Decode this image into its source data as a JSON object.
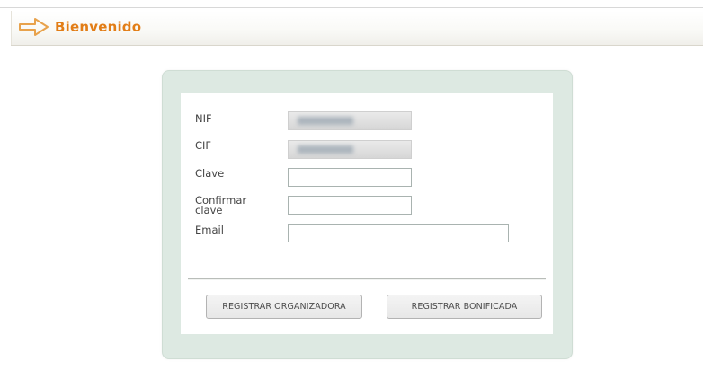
{
  "header": {
    "title": "Bienvenido",
    "icon": "arrow-right-icon",
    "title_color": "#e27d16"
  },
  "form": {
    "fields": {
      "nif": {
        "label": "NIF",
        "value": "",
        "disabled": true
      },
      "cif": {
        "label": "CIF",
        "value": "",
        "disabled": true
      },
      "clave": {
        "label": "Clave",
        "value": ""
      },
      "confirm": {
        "label": "Confirmar clave",
        "value": ""
      },
      "email": {
        "label": "Email",
        "value": ""
      }
    },
    "buttons": {
      "register_org": "REGISTRAR ORGANIZADORA",
      "register_bon": "REGISTRAR BONIFICADA"
    }
  },
  "colors": {
    "card_background": "#dde9e2",
    "accent": "#e27d16"
  }
}
